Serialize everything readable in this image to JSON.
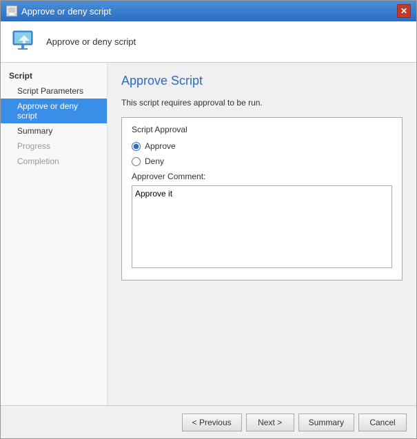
{
  "window": {
    "title": "Approve or deny script",
    "close_label": "✕"
  },
  "header": {
    "text": "Approve or deny script"
  },
  "sidebar": {
    "section_label": "Script",
    "items": [
      {
        "label": "Script Parameters",
        "state": "normal"
      },
      {
        "label": "Approve or deny script",
        "state": "active"
      },
      {
        "label": "Summary",
        "state": "normal"
      },
      {
        "label": "Progress",
        "state": "disabled"
      },
      {
        "label": "Completion",
        "state": "disabled"
      }
    ]
  },
  "content": {
    "page_title": "Approve Script",
    "description": "This script requires approval to be run.",
    "group_box_label": "Script Approval",
    "approve_label": "Approve",
    "deny_label": "Deny",
    "comment_label": "Approver Comment:",
    "comment_value": "Approve it"
  },
  "footer": {
    "previous_label": "< Previous",
    "next_label": "Next >",
    "summary_label": "Summary",
    "cancel_label": "Cancel"
  }
}
